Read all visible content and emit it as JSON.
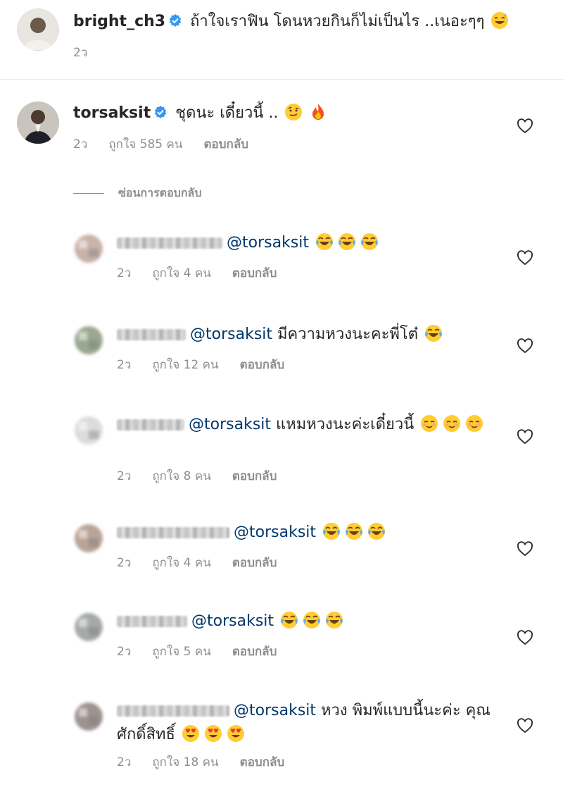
{
  "caption": {
    "username": "bright_ch3",
    "text": "ถ้าใจเราฟิน โดนหวยกินก็ไม่เป็นไร ..เนอะๆๆ",
    "emoji": "😅",
    "time": "2ว"
  },
  "main_comment": {
    "username": "torsaksit",
    "text": "ชุดนะ เดี๋ยวนี้ ..",
    "emojis": [
      "🤨",
      "🔥"
    ],
    "time": "2ว",
    "likes": "ถูกใจ 585 คน",
    "reply": "ตอบกลับ"
  },
  "hide_replies_label": "ซ่อนการตอบกลับ",
  "replies": [
    {
      "mention": "@torsaksit",
      "text": "",
      "emojis": [
        "😂",
        "😂",
        "😂"
      ],
      "time": "2ว",
      "likes": "ถูกใจ 4 คน",
      "reply": "ตอบกลับ"
    },
    {
      "mention": "@torsaksit",
      "text": "มีความหวงนะคะพี่โต๋",
      "emojis": [
        "😂"
      ],
      "time": "2ว",
      "likes": "ถูกใจ 12 คน",
      "reply": "ตอบกลับ"
    },
    {
      "mention": "@torsaksit",
      "text": "แหมหวงนะค่ะเดี๋ยวนี้",
      "emojis": [
        "☺️",
        "☺️",
        "☺️"
      ],
      "time": "2ว",
      "likes": "ถูกใจ 8 คน",
      "reply": "ตอบกลับ"
    },
    {
      "mention": "@torsaksit",
      "text": "",
      "emojis": [
        "😂",
        "😂",
        "😂"
      ],
      "time": "2ว",
      "likes": "ถูกใจ 4 คน",
      "reply": "ตอบกลับ"
    },
    {
      "mention": "@torsaksit",
      "text": "",
      "emojis": [
        "😂",
        "😂",
        "😂"
      ],
      "time": "2ว",
      "likes": "ถูกใจ 5 คน",
      "reply": "ตอบกลับ"
    },
    {
      "mention": "@torsaksit",
      "text": "หวง พิมพ์แบบนี้นะค่ะ คุณ ศักดิ์สิทธิ์",
      "emojis": [
        "😍",
        "😍",
        "😍"
      ],
      "time": "2ว",
      "likes": "ถูกใจ 18 คน",
      "reply": "ตอบกลับ"
    }
  ],
  "colors": {
    "text": "#262626",
    "meta": "#8e8e8e",
    "mention": "#00376b",
    "verified": "#3897f0",
    "divider": "#e6e6e6"
  },
  "icons": {
    "verified": "verified-badge-icon",
    "like": "heart-outline-icon"
  }
}
